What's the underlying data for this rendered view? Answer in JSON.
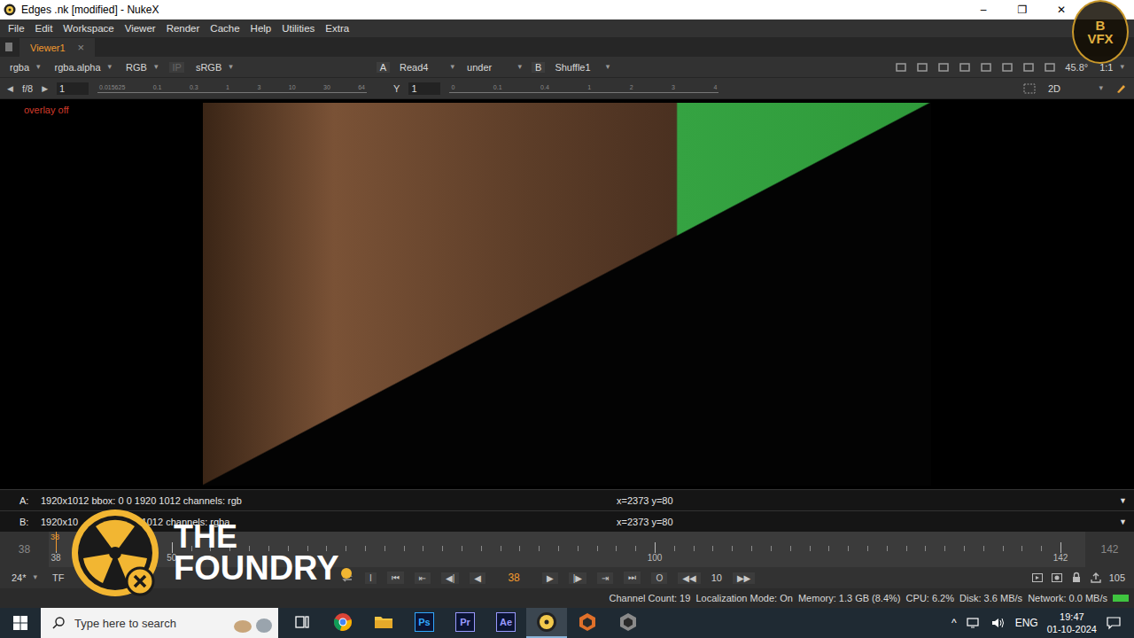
{
  "window": {
    "title": "Edges .nk [modified] - NukeX",
    "controls": [
      "–",
      "❐",
      "✕"
    ]
  },
  "badge_watermark": {
    "line1": "B",
    "line2": "VFX"
  },
  "menu": [
    "File",
    "Edit",
    "Workspace",
    "Viewer",
    "Render",
    "Cache",
    "Help",
    "Utilities",
    "Extra"
  ],
  "tabs": [
    {
      "label": "Viewer1",
      "selected": true,
      "close": "×"
    }
  ],
  "viewer_toolbar": {
    "arrow": "▾",
    "channels": "rgba",
    "alpha": "rgba.alpha",
    "display": "RGB",
    "ip": "IP",
    "lut": "sRGB",
    "a_label": "A",
    "a_input": "Read4",
    "mode": "under",
    "b_label": "B",
    "b_input": "Shuffle1",
    "angle": "45.8°",
    "zoom": "1:1"
  },
  "exposure_bar": {
    "prev": "◀",
    "next": "▶",
    "f_stop": "f/8",
    "gain": "1",
    "gain_ticks": [
      "0.015625",
      "0.1",
      "0.3",
      "1",
      "3",
      "10",
      "30",
      "64"
    ],
    "gamma_label": "Y",
    "gamma": "1",
    "gamma_ticks": [
      "0",
      "0.1",
      "0.4",
      "1",
      "2",
      "3",
      "4"
    ],
    "view_mode": "2D"
  },
  "viewer": {
    "overlay_status": "overlay off"
  },
  "info": [
    {
      "label": "A:",
      "segments": [
        "1920x1012  bbox: 0 0 1920 1012  channels: rgb"
      ],
      "coords": "x=2373 y=80",
      "arrow": "▼"
    },
    {
      "label": "B:",
      "segments": [
        "1920x10",
        "920 1012  channels: rgba"
      ],
      "coords": "x=2373 y=80",
      "arrow": "▼"
    }
  ],
  "timeline": {
    "start": "38",
    "end": "142",
    "current": "38",
    "marks": [
      "38",
      "50",
      "100",
      "142"
    ]
  },
  "playback": {
    "fps": "24*",
    "tf": "TF",
    "left_buttons": [
      "I",
      "⏮",
      "⇤",
      "◀|",
      "◀"
    ],
    "frame": "38",
    "right_buttons": [
      "▶",
      "|▶",
      "⇥",
      "⏭",
      "O"
    ],
    "step_back": "◀◀",
    "step": "10",
    "step_fwd": "▶▶",
    "end_frame": "105"
  },
  "status_bar": {
    "text": "Channel Count: 19  Localization Mode: On  Memory: 1.3 GB (8.4%)  CPU: 6.2%  Disk: 3.6 MB/s  Network: 0.0 MB/s"
  },
  "foundry_watermark": {
    "line1": "THE",
    "line2": "FOUNDRY"
  },
  "taskbar": {
    "search_placeholder": "Type here to search",
    "apps": [
      {
        "kind": "taskview",
        "label": "",
        "selected": false,
        "color": "#ffffff"
      },
      {
        "kind": "chrome",
        "label": "",
        "selected": false,
        "color": "#4285f4"
      },
      {
        "kind": "folder",
        "label": "",
        "selected": false,
        "color": "#f4c542"
      },
      {
        "kind": "adobe",
        "label": "Ps",
        "selected": false,
        "color": "#31a8ff"
      },
      {
        "kind": "adobe",
        "label": "Pr",
        "selected": false,
        "color": "#9999ff"
      },
      {
        "kind": "adobe",
        "label": "Ae",
        "selected": false,
        "color": "#9999ff"
      },
      {
        "kind": "nuke",
        "label": "",
        "selected": true,
        "color": "#f2c94c"
      },
      {
        "kind": "hex",
        "label": "",
        "selected": false,
        "color": "#e0702a"
      },
      {
        "kind": "hex",
        "label": "",
        "selected": false,
        "color": "#8a8a8a"
      }
    ],
    "tray": {
      "chevron": "^",
      "lang": "ENG",
      "time": "19:47",
      "date": "01-10-2024"
    }
  }
}
